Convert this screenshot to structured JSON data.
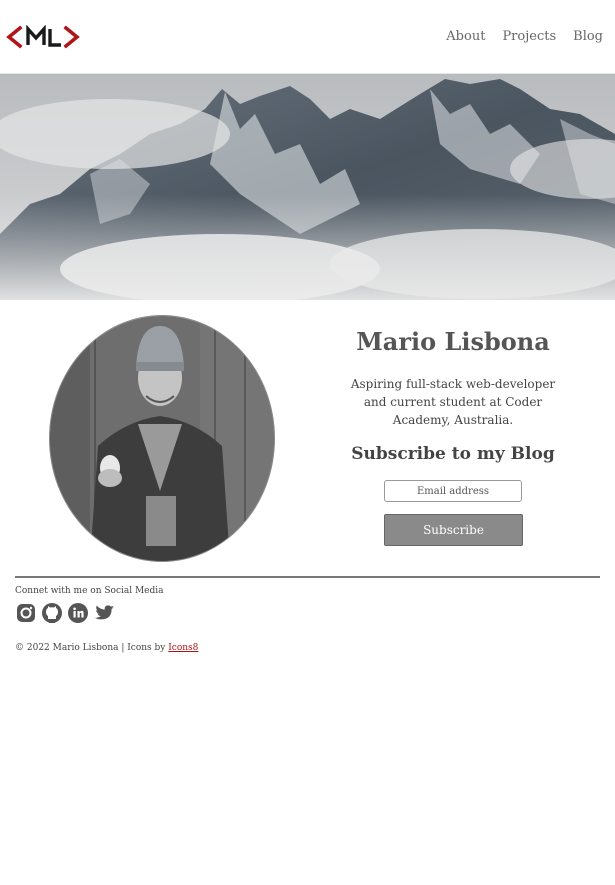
{
  "header": {
    "logo_text": "<ML>",
    "nav": [
      "About",
      "Projects",
      "Blog"
    ]
  },
  "profile": {
    "name": "Mario Lisbona",
    "tagline": "Aspiring full-stack web-developer and current student at Coder Academy, Australia."
  },
  "subscribe": {
    "title": "Subscribe to my Blog",
    "email_placeholder": "Email address",
    "button_label": "Subscribe"
  },
  "social": {
    "label": "Connet with me on Social Media",
    "icons": [
      "instagram-icon",
      "github-icon",
      "linkedin-icon",
      "twitter-icon"
    ]
  },
  "footer": {
    "copyright": "© 2022 Mario Lisbona | Icons by",
    "credit_link": "Icons8"
  },
  "colors": {
    "logo_red": "#b0151a",
    "logo_dark": "#1a1a1a",
    "button_gray": "#8a8a8a",
    "link_red": "#b0151a"
  }
}
